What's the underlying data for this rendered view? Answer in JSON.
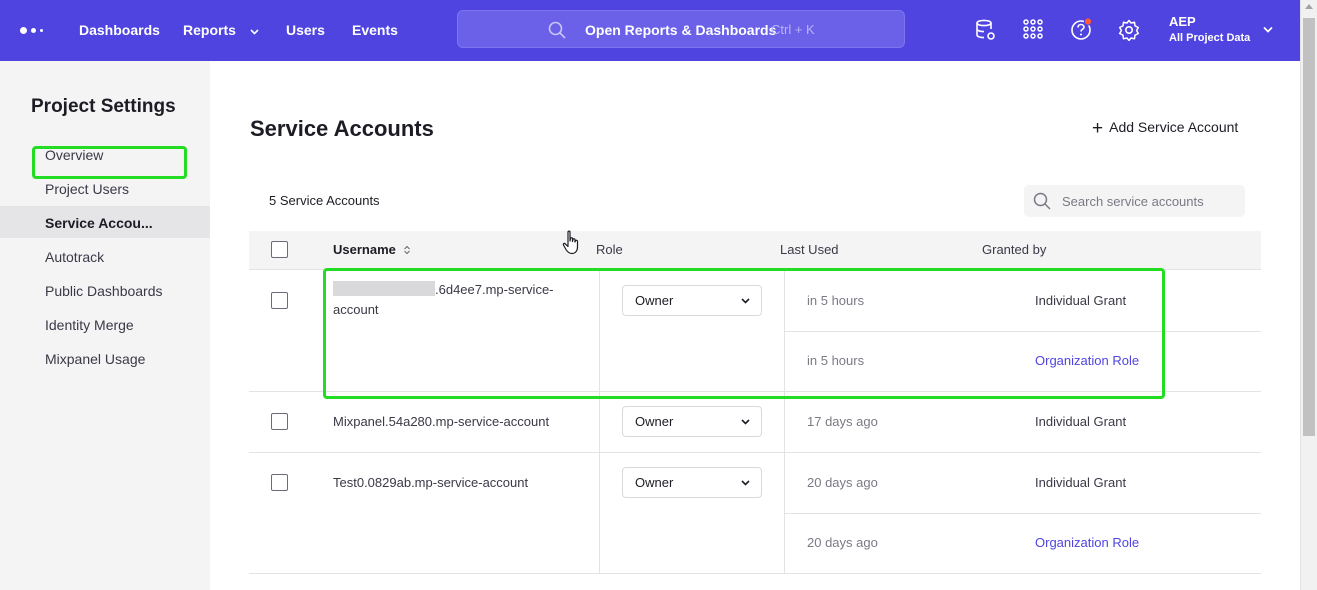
{
  "nav": {
    "items": [
      {
        "label": "Dashboards"
      },
      {
        "label": "Reports"
      },
      {
        "label": "Users"
      },
      {
        "label": "Events"
      }
    ],
    "search_label": "Open Reports & Dashboards",
    "search_shortcut": "Ctrl + K",
    "project_name": "AEP",
    "project_scope": "All Project Data",
    "icons": [
      "data-settings-icon",
      "apps-grid-icon",
      "help-icon",
      "gear-icon"
    ],
    "brand_color": "#4f44e0",
    "help_badge_color": "#ff5a3c"
  },
  "sidebar": {
    "title": "Project Settings",
    "items": [
      {
        "label": "Overview"
      },
      {
        "label": "Project Users"
      },
      {
        "label": "Service Accou..."
      },
      {
        "label": "Autotrack"
      },
      {
        "label": "Public Dashboards"
      },
      {
        "label": "Identity Merge"
      },
      {
        "label": "Mixpanel Usage"
      }
    ],
    "active_index": 2
  },
  "main": {
    "title": "Service Accounts",
    "add_label": "Add Service Account",
    "count_label": "5 Service Accounts",
    "search_placeholder": "Search service accounts",
    "columns": {
      "username": "Username",
      "role": "Role",
      "last_used": "Last Used",
      "granted_by": "Granted by"
    },
    "rows": [
      {
        "username_suffix": ".6d4ee7.mp-service-account",
        "role": "Owner",
        "grants": [
          {
            "last_used": "in 5 hours",
            "granted_by": "Individual Grant"
          },
          {
            "last_used": "in 5 hours",
            "granted_by": "Organization Role"
          }
        ]
      },
      {
        "username": "Mixpanel.54a280.mp-service-account",
        "role": "Owner",
        "grants": [
          {
            "last_used": "17 days ago",
            "granted_by": "Individual Grant"
          }
        ]
      },
      {
        "username": "Test0.0829ab.mp-service-account",
        "role": "Owner",
        "grants": [
          {
            "last_used": "20 days ago",
            "granted_by": "Individual Grant"
          },
          {
            "last_used": "20 days ago",
            "granted_by": "Organization Role"
          }
        ]
      }
    ],
    "highlight_color": "#22dd22",
    "link_color": "#4f44e0"
  }
}
